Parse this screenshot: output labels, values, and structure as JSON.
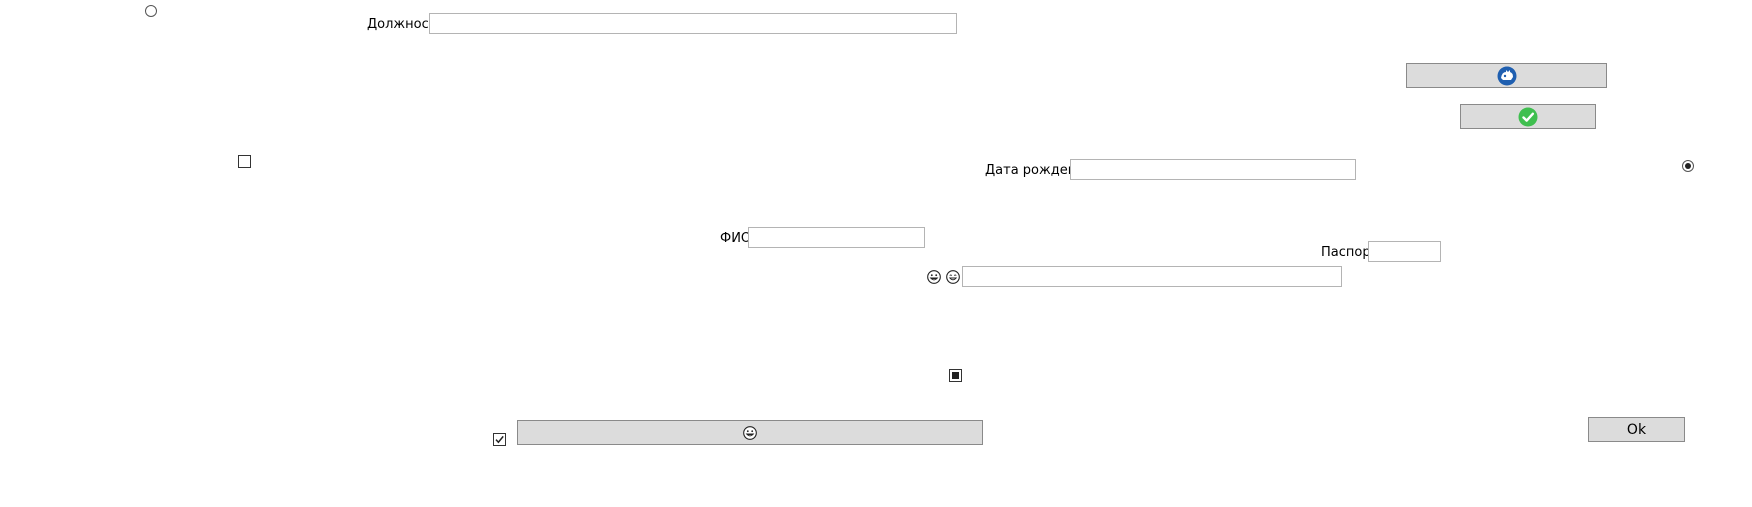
{
  "form": {
    "position_label": "Должность",
    "position_value": "",
    "birthdate_label": "Дата рождения",
    "birthdate_value": "",
    "fio_label": "ФИО",
    "fio_value": "",
    "passport_label": "Паспорт",
    "passport_value": "",
    "emoji_field_value": ""
  },
  "buttons": {
    "ok_label": "Ok"
  },
  "icons": {
    "top_button_icon": "blue-mascot-icon",
    "confirm_button_icon": "green-check-icon",
    "emoji_label_icons": [
      "grinning-face-icon",
      "smiling-face-icon"
    ],
    "wide_button_icon": "grinning-face-icon"
  },
  "controls": {
    "radio_top_left_checked": false,
    "radio_right_checked": true,
    "checkbox_left_checked": false,
    "checkbox_middle_state": "indeterminate",
    "checkbox_bottom_checked": true
  },
  "colors": {
    "button_bg": "#dcdcdc",
    "input_border": "#b4b4b4",
    "check_green": "#3fbf4f",
    "mascot_blue": "#1f5fb0"
  }
}
